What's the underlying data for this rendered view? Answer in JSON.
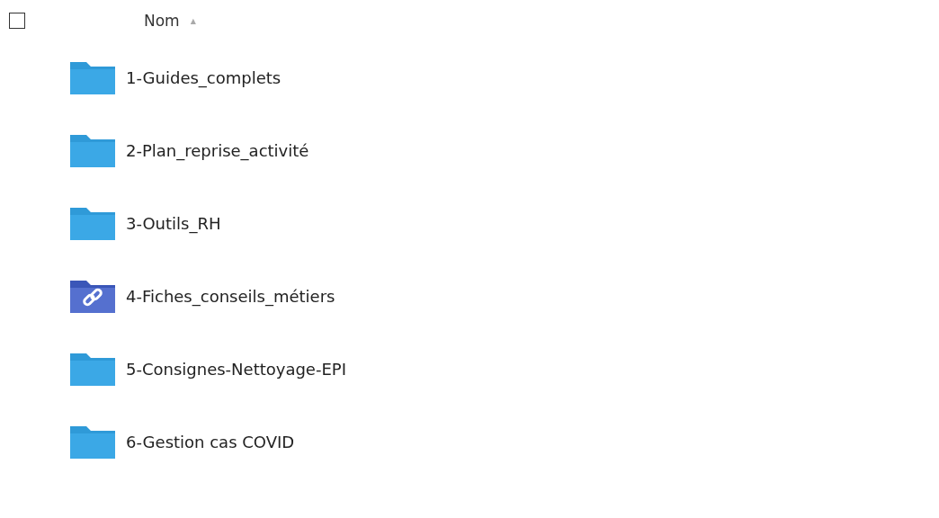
{
  "header": {
    "select_all": {
      "checked": false
    },
    "column": "Nom",
    "sort_indicator": "▲"
  },
  "items": [
    {
      "name": "1-Guides_complets",
      "kind": "folder"
    },
    {
      "name": "2-Plan_reprise_activité",
      "kind": "folder"
    },
    {
      "name": "3-Outils_RH",
      "kind": "folder"
    },
    {
      "name": "4-Fiches_conseils_métiers",
      "kind": "link"
    },
    {
      "name": "5-Consignes-Nettoyage-EPI",
      "kind": "folder"
    },
    {
      "name": "6-Gestion cas COVID",
      "kind": "folder"
    }
  ]
}
